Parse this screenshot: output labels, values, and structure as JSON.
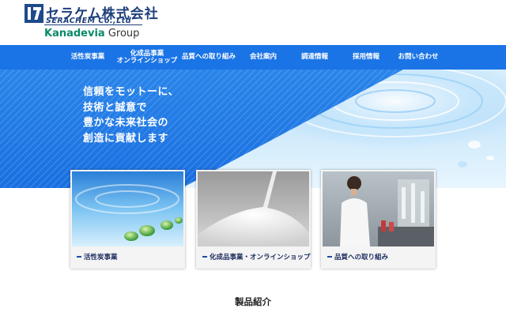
{
  "header": {
    "company_name": "セラケム株式会社",
    "company_romaji": "SERACHEM Co.,Ltd",
    "group_brand": "Kanadevia",
    "group_suffix": " Group"
  },
  "nav": {
    "items": [
      {
        "label": "活性炭事業"
      },
      {
        "label_line1": "化成品事業",
        "label_line2": "オンラインショップ"
      },
      {
        "label": "品質への取り組み"
      },
      {
        "label": "会社案内"
      },
      {
        "label": "調達情報"
      },
      {
        "label": "採用情報"
      },
      {
        "label": "お問い合わせ"
      }
    ]
  },
  "hero": {
    "lines": [
      "信頼をモットーに、",
      "技術と誠意で",
      "豊かな未来社会の",
      "創造に貢献します"
    ]
  },
  "cards": [
    {
      "label": "活性炭事業"
    },
    {
      "label": "化成品事業・オンラインショップ"
    },
    {
      "label": "品質への取り組み"
    }
  ],
  "section": {
    "title": "製品紹介"
  },
  "colors": {
    "nav_blue": "#1a74e6",
    "brand_navy": "#1e3f7a",
    "group_green": "#0a8a6a"
  }
}
